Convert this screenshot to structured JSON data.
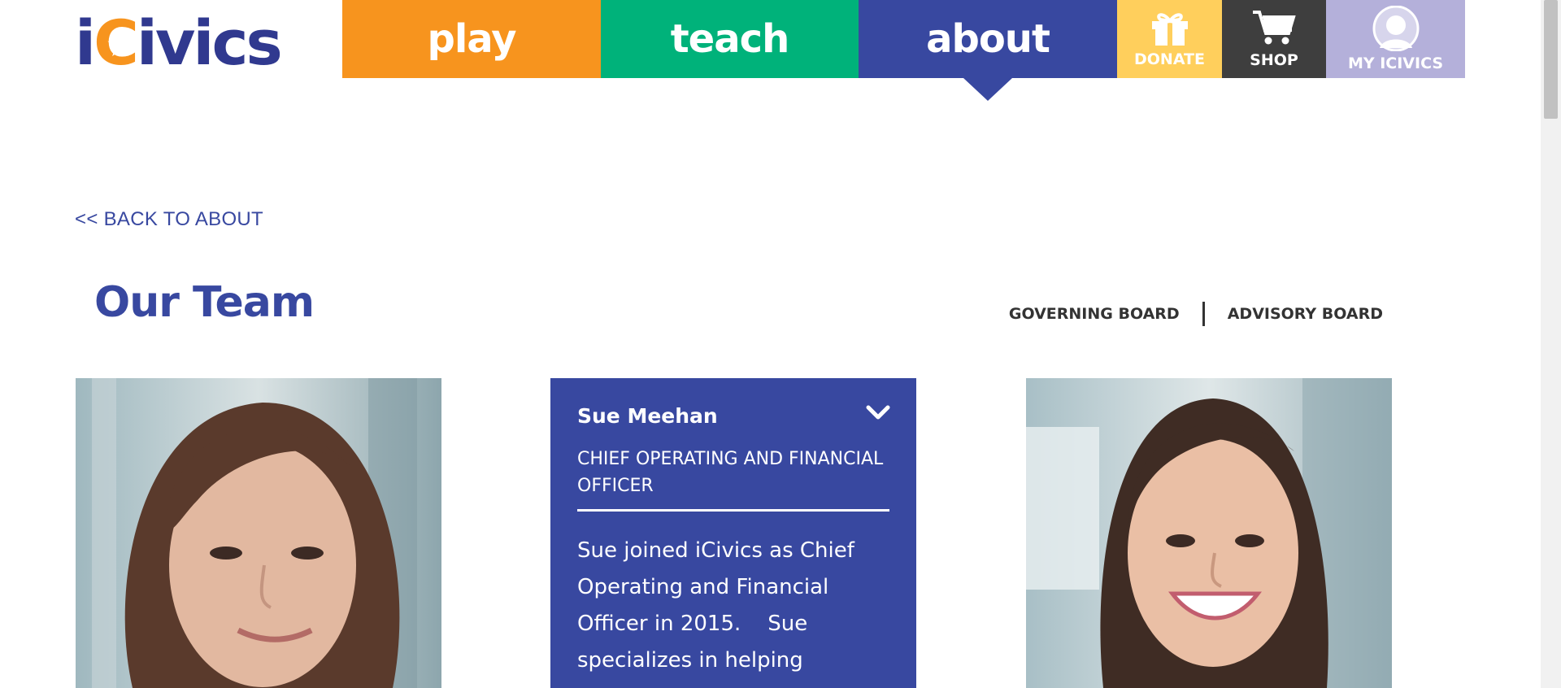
{
  "header": {
    "logo_text": "iCivics",
    "nav": {
      "play": "play",
      "teach": "teach",
      "about": "about",
      "donate": "DONATE",
      "shop": "SHOP",
      "my_icivics": "MY ICIVICS"
    }
  },
  "main": {
    "back_link": "<< BACK TO ABOUT",
    "title": "Our Team",
    "board_links": {
      "governing": "GOVERNING BOARD",
      "advisory": "ADVISORY BOARD"
    }
  },
  "team": {
    "featured": {
      "name": "Sue Meehan",
      "role": "CHIEF OPERATING AND FINANCIAL OFFICER",
      "bio": "Sue joined iCivics as Chief Operating and Financial Officer in 2015.    Sue specializes in helping"
    }
  },
  "colors": {
    "play": "#f7941e",
    "teach": "#00b27a",
    "about": "#3848a0",
    "donate": "#ffcf5c",
    "shop": "#3e3e3e",
    "my_icivics": "#b4b0da",
    "brand_navy": "#30398f"
  },
  "icons": {
    "donate": "gift-icon",
    "shop": "cart-icon",
    "my_icivics": "avatar-icon",
    "bio_toggle": "chevron-down-icon"
  }
}
